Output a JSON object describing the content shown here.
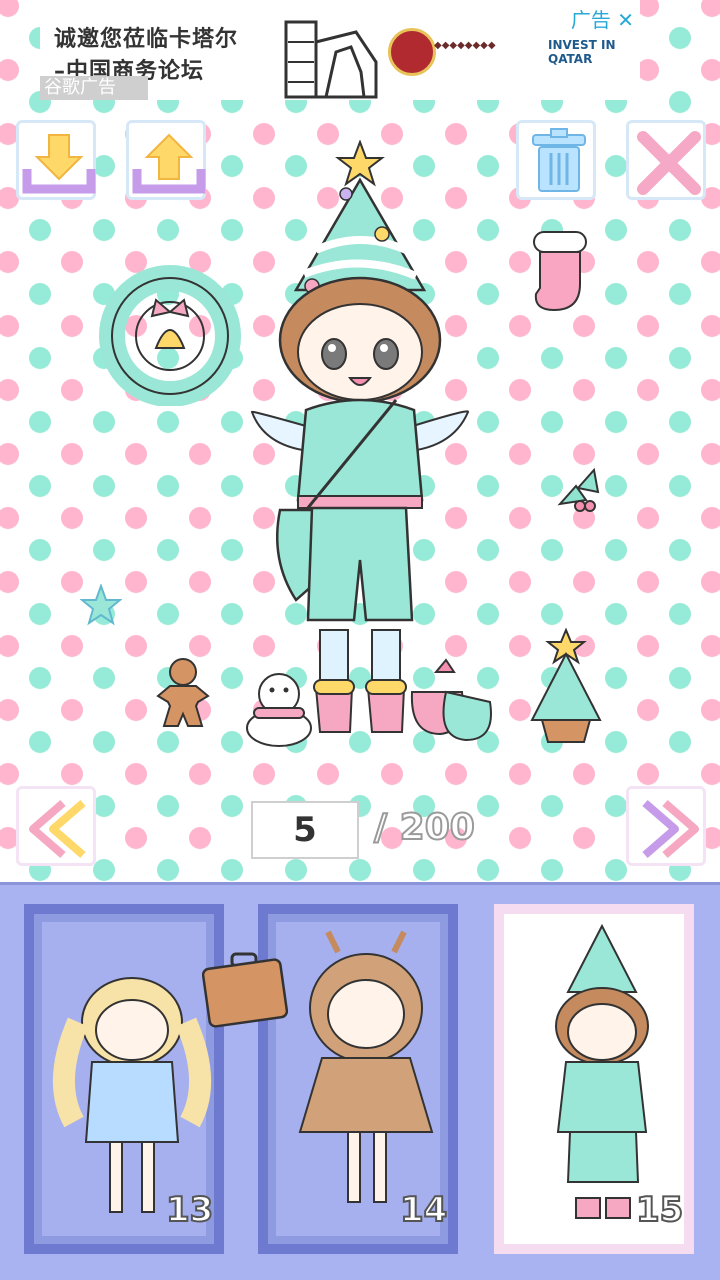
{
  "ad": {
    "headline_line1": "诚邀您莅临卡塔尔",
    "headline_line2": "–中国商务论坛",
    "google_label": "谷歌广告",
    "choice_label": "广告 ✕",
    "invest_label": "INVEST IN QATAR"
  },
  "toolbar": {
    "import_icon": "download-tray-icon",
    "export_icon": "upload-tray-icon",
    "trash_icon": "trash-icon",
    "close_icon": "close-x-icon"
  },
  "pager": {
    "current": "5",
    "total": "/ 200",
    "prev_icon": "double-chevron-left-icon",
    "next_icon": "double-chevron-right-icon"
  },
  "characters": [
    {
      "number": "13",
      "selected": false
    },
    {
      "number": "14",
      "selected": false
    },
    {
      "number": "15",
      "selected": true
    }
  ],
  "colors": {
    "mint": "#96ead8",
    "pink": "#ffb5cd",
    "panel": "#aab3f1",
    "card_border": "#6d7ad0"
  }
}
